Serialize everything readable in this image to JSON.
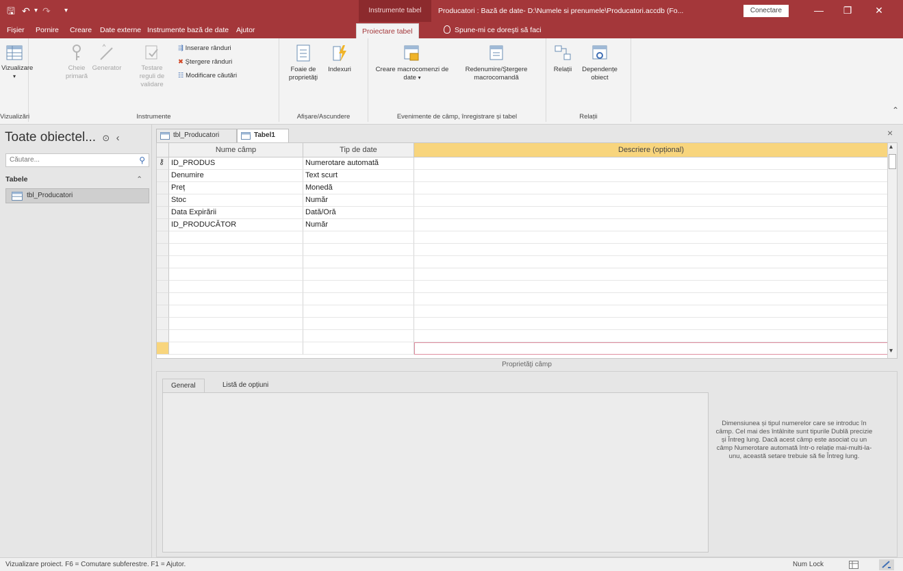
{
  "titlebar": {
    "contextual_tab_group": "Instrumente tabel",
    "window_title": "Producatori : Bază de date- D:\\Numele si prenumele\\Producatori.accdb (Fo...",
    "connect_label": "Conectare",
    "min_glyph": "—",
    "restore_glyph": "❐",
    "close_glyph": "✕",
    "save_glyph": "🖫",
    "undo_glyph": "↶",
    "redo_glyph": "↷",
    "qat_more_glyph": "▾"
  },
  "ribbon_tabs": {
    "fisier": "Fișier",
    "pornire": "Pornire",
    "creare": "Creare",
    "date_externe": "Date externe",
    "instrumente_bd": "Instrumente bază de date",
    "ajutor": "Ajutor",
    "proiectare": "Proiectare tabel",
    "tell_me": "Spune-mi ce doreşti să faci"
  },
  "ribbon": {
    "vizualizare": "Vizualizare",
    "vizualizari_group": "Vizualizări",
    "cheie_primara": "Cheie primară",
    "generator": "Generator",
    "testare_reguli": "Testare reguli de validare",
    "inserare_randuri": "Inserare rânduri",
    "stergere_randuri": "Ştergere rânduri",
    "modificare_cautari": "Modificare căutări",
    "instrumente_group": "Instrumente",
    "foaie_proprietati": "Foaie de proprietăţi",
    "indexuri": "Indexuri",
    "afisare_group": "Afișare/Ascundere",
    "creare_macro": "Creare macrocomenzi de date",
    "redenumire_macro": "Redenumire/Ştergere macrocomandă",
    "evenimente_group": "Evenimente de câmp, înregistrare și tabel",
    "relatii": "Relații",
    "dependente": "Dependențe obiect",
    "relatii_group": "Relații",
    "collapse_glyph": "⌃"
  },
  "nav": {
    "title": "Toate obiectel...",
    "options_glyph": "⊙",
    "shutter_glyph": "‹",
    "search_placeholder": "Căutare...",
    "search_glyph": "⚲",
    "section": "Tabele",
    "section_glyph": "⌃",
    "item": "tbl_Producatori"
  },
  "doc_tabs": {
    "tab1": "tbl_Producatori",
    "tab2": "Tabel1",
    "close_glyph": "×"
  },
  "grid": {
    "headers": [
      "Nume câmp",
      "Tip de date",
      "Descriere (opțional)"
    ],
    "rows": [
      {
        "field": "ID_PRODUS",
        "type": "Numerotare automată",
        "key": true
      },
      {
        "field": "Denumire",
        "type": "Text scurt"
      },
      {
        "field": "Preț",
        "type": "Monedă"
      },
      {
        "field": "Stoc",
        "type": "Număr"
      },
      {
        "field": "Data Expirării",
        "type": "Dată/Oră"
      },
      {
        "field": "ID_PRODUCĂTOR",
        "type": "Număr"
      }
    ],
    "key_glyph": "⚷",
    "scroll_up": "▴",
    "scroll_down": "▾"
  },
  "props": {
    "caption": "Proprietăţi câmp",
    "tab_general": "General",
    "tab_lookup": "Listă de opțiuni",
    "help": "Dimensiunea și tipul numerelor care se introduc în câmp. Cel mai des întâlnite sunt tipurile Dublă precizie și Întreg lung. Dacă acest câmp este asociat cu un câmp Numerotare automată într-o relație mai-multi-la-unu, această setare trebuie să fie Întreg lung."
  },
  "status": {
    "text": "Vizualizare proiect. F6 = Comutare subferestre. F1 = Ajutor.",
    "numlock": "Num Lock"
  },
  "colors": {
    "accent": "#a4373a",
    "selector": "#f8d57d"
  }
}
